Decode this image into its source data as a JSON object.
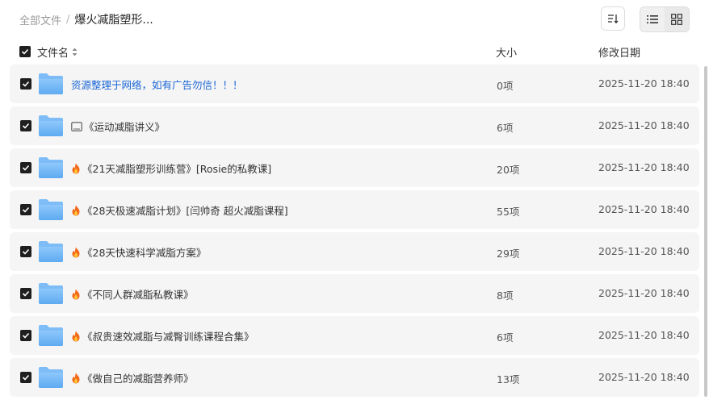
{
  "breadcrumb": {
    "root": "全部文件",
    "separator": "/",
    "current": "爆火减脂塑形..."
  },
  "toolbar": {
    "sort_icon": "sort-icon",
    "list_view_icon": "list-view-icon",
    "grid_view_icon": "grid-view-icon"
  },
  "columns": {
    "name": "文件名",
    "size": "大小",
    "date": "修改日期"
  },
  "files": [
    {
      "name": "资源整理于网络，如有广告勿信！！！",
      "size": "0项",
      "date": "2025-11-20 18:40",
      "lead_icon": "",
      "link": true
    },
    {
      "name": "《运动减脂讲义》",
      "size": "6项",
      "date": "2025-11-20 18:40",
      "lead_icon": "tablet-icon",
      "link": false
    },
    {
      "name": "《21天减脂塑形训练营》[Rosie的私教课]",
      "size": "20项",
      "date": "2025-11-20 18:40",
      "lead_icon": "fire-icon",
      "link": false
    },
    {
      "name": "《28天极速减脂计划》[闫帅奇 超火减脂课程]",
      "size": "55项",
      "date": "2025-11-20 18:40",
      "lead_icon": "fire-icon",
      "link": false
    },
    {
      "name": "《28天快速科学减脂方案》",
      "size": "29项",
      "date": "2025-11-20 18:40",
      "lead_icon": "fire-icon",
      "link": false
    },
    {
      "name": "《不同人群减脂私教课》",
      "size": "8项",
      "date": "2025-11-20 18:40",
      "lead_icon": "fire-icon",
      "link": false
    },
    {
      "name": "《叔贵速效减脂与减臀训练课程合集》",
      "size": "6项",
      "date": "2025-11-20 18:40",
      "lead_icon": "fire-icon",
      "link": false
    },
    {
      "name": "《做自己的减脂营养师》",
      "size": "13项",
      "date": "2025-11-20 18:40",
      "lead_icon": "fire-icon",
      "link": false
    }
  ]
}
